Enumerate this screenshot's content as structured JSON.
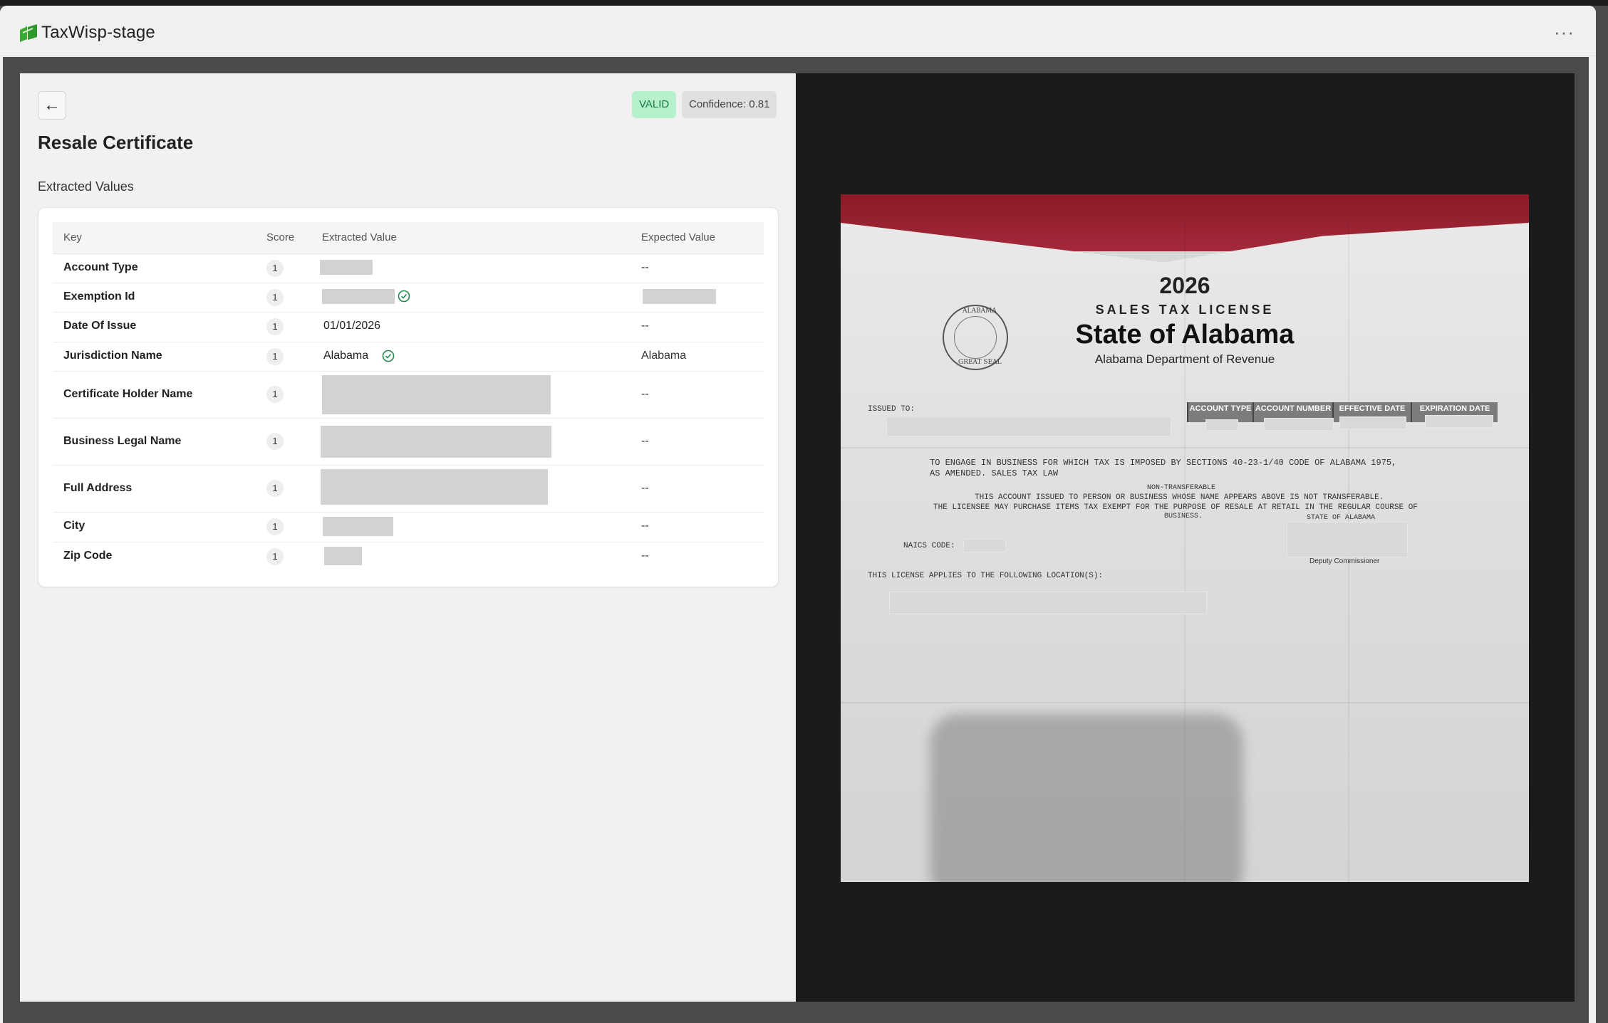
{
  "app": {
    "title": "TaxWisp-stage",
    "more_label": "···"
  },
  "header": {
    "back_label": "←",
    "status_badge": "VALID",
    "confidence": "Confidence: 0.81",
    "page_title": "Resale Certificate"
  },
  "colors": {
    "valid_bg": "#b7f0cc",
    "valid_text": "#137a3b",
    "check": "#1f8a4c"
  },
  "section_label": "Extracted Values",
  "table": {
    "columns": [
      "Key",
      "Score",
      "Extracted Value",
      "Expected Value"
    ],
    "rows": [
      {
        "key": "Account Type",
        "score": "1",
        "extracted": "",
        "expected": "--"
      },
      {
        "key": "Exemption Id",
        "score": "1",
        "extracted": "",
        "expected": ""
      },
      {
        "key": "Date Of Issue",
        "score": "1",
        "extracted": "01/01/2026",
        "expected": "--"
      },
      {
        "key": "Jurisdiction Name",
        "score": "1",
        "extracted": "Alabama",
        "expected": "Alabama"
      },
      {
        "key": "Certificate Holder Name",
        "score": "1",
        "extracted": "",
        "expected": "--"
      },
      {
        "key": "Business Legal Name",
        "score": "1",
        "extracted": "",
        "expected": "--"
      },
      {
        "key": "Full Address",
        "score": "1",
        "extracted": "",
        "expected": "--"
      },
      {
        "key": "City",
        "score": "1",
        "extracted": "",
        "expected": "--"
      },
      {
        "key": "Zip Code",
        "score": "1",
        "extracted": "",
        "expected": "--"
      }
    ]
  },
  "document": {
    "year": "2026",
    "subtitle": "SALES TAX LICENSE",
    "state": "State of Alabama",
    "dept": "Alabama Department of Revenue",
    "seal_top": "ALABAMA",
    "seal_bottom": "GREAT SEAL",
    "issued_to": "ISSUED TO:",
    "header_cells": [
      "ACCOUNT TYPE",
      "ACCOUNT NUMBER",
      "EFFECTIVE DATE",
      "EXPIRATION DATE"
    ],
    "engage_line1": "TO ENGAGE IN BUSINESS FOR WHICH TAX IS IMPOSED BY SECTIONS 40-23-1/40 CODE OF ALABAMA 1975,",
    "engage_line2": "AS AMENDED.  SALES TAX LAW",
    "non_transferable": "NON-TRANSFERABLE",
    "account_line": "THIS ACCOUNT ISSUED TO PERSON OR BUSINESS WHOSE NAME APPEARS ABOVE IS NOT TRANSFERABLE.",
    "licensee_line1": "THE LICENSEE MAY PURCHASE ITEMS TAX EXEMPT FOR THE PURPOSE OF RESALE AT RETAIL IN THE REGULAR COURSE OF",
    "licensee_line2": "BUSINESS.",
    "naics": "NAICS CODE:",
    "state_of_alabama": "STATE OF ALABAMA",
    "deputy": "Deputy Commissioner",
    "applies": "THIS LICENSE APPLIES TO THE FOLLOWING LOCATION(S):"
  }
}
